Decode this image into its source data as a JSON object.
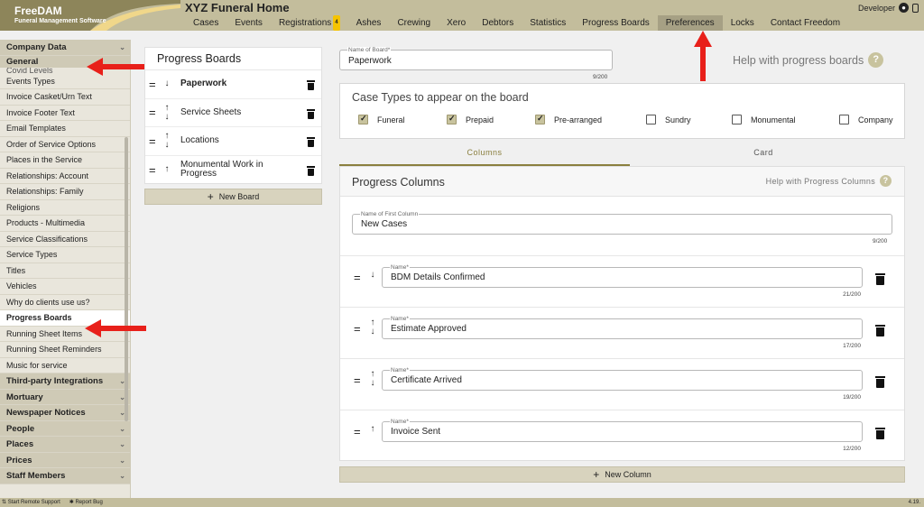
{
  "header": {
    "logo_name": "FreeDAM",
    "logo_sub": "Funeral Management Software",
    "title": "XYZ Funeral Home",
    "user": "Developer",
    "nav": [
      {
        "label": "Cases"
      },
      {
        "label": "Events"
      },
      {
        "label": "Registrations",
        "badge": "4"
      },
      {
        "label": "Ashes"
      },
      {
        "label": "Crewing"
      },
      {
        "label": "Xero"
      },
      {
        "label": "Debtors"
      },
      {
        "label": "Statistics"
      },
      {
        "label": "Progress Boards"
      },
      {
        "label": "Preferences",
        "active": true
      },
      {
        "label": "Locks"
      },
      {
        "label": "Contact Freedom"
      }
    ]
  },
  "sidebar": {
    "company_data": "Company Data",
    "general": "General",
    "covid_partial": "Covid Levels",
    "items": [
      "Events Types",
      "Invoice Casket/Urn Text",
      "Invoice Footer Text",
      "Email Templates",
      "Order of Service Options",
      "Places in the Service",
      "Relationships: Account",
      "Relationships: Family",
      "Religions",
      "Products - Multimedia",
      "Service Classifications",
      "Service Types",
      "Titles",
      "Vehicles",
      "Why do clients use us?",
      "Progress Boards",
      "Running Sheet Items",
      "Running Sheet Reminders",
      "Music for service"
    ],
    "active_item": "Progress Boards",
    "sections": [
      "Third-party Integrations",
      "Mortuary",
      "Newspaper Notices",
      "People",
      "Places",
      "Prices",
      "Staff Members"
    ]
  },
  "statusbar": {
    "remote": "Start Remote Support",
    "bug": "Report Bug",
    "version": "4.19."
  },
  "boards": {
    "title": "Progress Boards",
    "items": [
      {
        "name": "Paperwork",
        "arrows": "down",
        "selected": true
      },
      {
        "name": "Service Sheets",
        "arrows": "both"
      },
      {
        "name": "Locations",
        "arrows": "both"
      },
      {
        "name": "Monumental Work in Progress",
        "arrows": "up"
      }
    ],
    "new_button": "New Board"
  },
  "board_form": {
    "name_label": "Name of Board*",
    "name_value": "Paperwork",
    "name_counter": "9/200",
    "help_link": "Help with progress boards",
    "case_types_title": "Case Types to appear on the board",
    "case_types": [
      {
        "label": "Funeral",
        "checked": true
      },
      {
        "label": "Prepaid",
        "checked": true
      },
      {
        "label": "Pre-arranged",
        "checked": true
      },
      {
        "label": "Sundry",
        "checked": false
      },
      {
        "label": "Monumental",
        "checked": false
      },
      {
        "label": "Company",
        "checked": false
      }
    ],
    "tabs": {
      "columns": "Columns",
      "card": "Card"
    }
  },
  "progress_columns": {
    "title": "Progress Columns",
    "help_link": "Help with Progress Columns",
    "first_label": "Name of First Column",
    "first_value": "New Cases",
    "first_counter": "9/200",
    "name_label": "Name*",
    "rows": [
      {
        "value": "BDM Details Confirmed",
        "counter": "21/200",
        "arrows": "down"
      },
      {
        "value": "Estimate Approved",
        "counter": "17/200",
        "arrows": "both"
      },
      {
        "value": "Certificate Arrived",
        "counter": "19/200",
        "arrows": "both"
      },
      {
        "value": "Invoice Sent",
        "counter": "12/200",
        "arrows": "up"
      }
    ],
    "new_button": "New Column"
  },
  "colors": {
    "header": "#c3bd9c",
    "accent": "#8a7f3e",
    "annotation": "#e8201a"
  }
}
